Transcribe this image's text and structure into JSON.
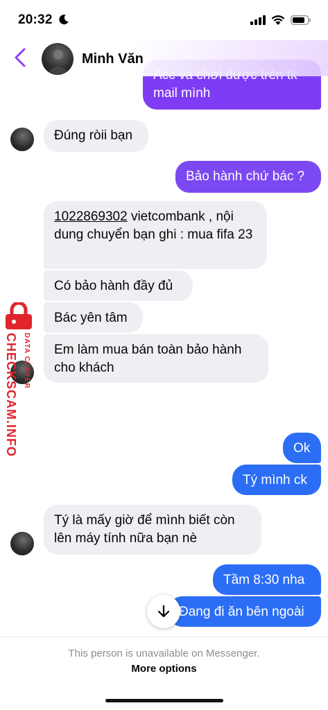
{
  "status_bar": {
    "time": "20:32",
    "icons": [
      "moon-icon",
      "cellular-signal-icon",
      "wifi-icon",
      "battery-icon"
    ]
  },
  "header": {
    "contact_name": "Minh Văn",
    "back_icon": "chevron-left-icon"
  },
  "messages": [
    {
      "side": "out",
      "text": "Acc và chơi được trên tk mail mình"
    },
    {
      "side": "in",
      "text": "Đúng ròii bạn"
    },
    {
      "side": "out",
      "text": "Bảo hành chứ bác ?"
    },
    {
      "side": "in",
      "account": "1022869302",
      "text": " vietcombank , nội dung chuyển bạn ghi : mua fifa 23"
    },
    {
      "side": "in",
      "text": "Có bảo hành đầy đủ"
    },
    {
      "side": "in",
      "text": "Bác yên tâm"
    },
    {
      "side": "in",
      "text": "Em làm mua bán toàn bảo hành cho khách"
    },
    {
      "side": "out",
      "type": "like",
      "icon": "thumbs-up-icon"
    },
    {
      "side": "out",
      "text": "Ok"
    },
    {
      "side": "out",
      "text": "Tý mình ck"
    },
    {
      "side": "in",
      "text": "Tý là mấy giờ để mình biết còn lên máy tính nữa bạn nè"
    },
    {
      "side": "out",
      "text": "Tầm 8:30 nha"
    },
    {
      "side": "out",
      "text": "Đang đi ăn bên ngoài"
    }
  ],
  "watermark": {
    "site": "CHECKSCAM.INFO",
    "tagline": "DATA CENTER"
  },
  "scroll_button_icon": "arrow-down-icon",
  "footer": {
    "note": "This person is unavailable on Messenger.",
    "link": "More options"
  },
  "colors": {
    "outgoing_purple": "#7e3df4",
    "outgoing_blue": "#2b6ef5",
    "incoming": "#eeeff2",
    "back_arrow": "#8a3ffc",
    "watermark": "#e0242b"
  }
}
